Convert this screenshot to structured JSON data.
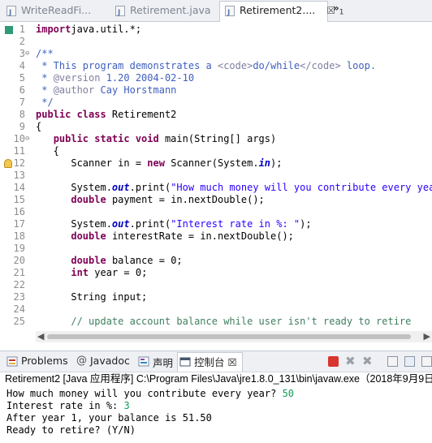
{
  "tabs": [
    {
      "label": "WriteReadFi...",
      "active": false
    },
    {
      "label": "Retirement.java",
      "active": false
    },
    {
      "label": "Retirement2....",
      "active": true,
      "close": "☒"
    }
  ],
  "overflow": {
    "symbol": "»",
    "count": "1"
  },
  "code_lines": [
    {
      "n": "1",
      "marker": "square",
      "parts": [
        [
          "kw",
          "import"
        ],
        [
          "",
          "java.util.*;"
        ]
      ]
    },
    {
      "n": "2",
      "parts": []
    },
    {
      "n": "3",
      "fold": "⊖",
      "parts": [
        [
          "cm",
          "/**"
        ]
      ]
    },
    {
      "n": "4",
      "parts": [
        [
          "cm",
          " * This program demonstrates a "
        ],
        [
          "tg",
          "<code>"
        ],
        [
          "cm",
          "do/while"
        ],
        [
          "tg",
          "</code>"
        ],
        [
          "cm",
          " loop."
        ]
      ]
    },
    {
      "n": "5",
      "parts": [
        [
          "cm",
          " * "
        ],
        [
          "tg",
          "@version"
        ],
        [
          "cm",
          " 1.20 2004-02-10"
        ]
      ]
    },
    {
      "n": "6",
      "parts": [
        [
          "cm",
          " * "
        ],
        [
          "tg",
          "@author"
        ],
        [
          "cm",
          " Cay Horstmann"
        ]
      ]
    },
    {
      "n": "7",
      "parts": [
        [
          "cm",
          " */"
        ]
      ]
    },
    {
      "n": "8",
      "parts": [
        [
          "kw",
          "public class"
        ],
        [
          "",
          " Retirement2"
        ]
      ]
    },
    {
      "n": "9",
      "parts": [
        [
          "",
          "{"
        ]
      ]
    },
    {
      "n": "10",
      "fold": "⊖",
      "parts": [
        [
          "",
          "   "
        ],
        [
          "kw",
          "public static void"
        ],
        [
          "",
          " main(String[] args)"
        ]
      ]
    },
    {
      "n": "11",
      "parts": [
        [
          "",
          "   {"
        ]
      ]
    },
    {
      "n": "12",
      "marker": "bulb",
      "parts": [
        [
          "",
          "      Scanner in = "
        ],
        [
          "kw",
          "new"
        ],
        [
          "",
          " Scanner(System."
        ],
        [
          "it",
          "in"
        ],
        [
          "",
          ");"
        ]
      ]
    },
    {
      "n": "13",
      "parts": []
    },
    {
      "n": "14",
      "parts": [
        [
          "",
          "      System."
        ],
        [
          "it",
          "out"
        ],
        [
          "",
          ".print("
        ],
        [
          "str",
          "\"How much money will you contribute every year?\""
        ]
      ]
    },
    {
      "n": "15",
      "parts": [
        [
          "",
          "      "
        ],
        [
          "kw",
          "double"
        ],
        [
          "",
          " payment = in.nextDouble();"
        ]
      ]
    },
    {
      "n": "16",
      "parts": []
    },
    {
      "n": "17",
      "parts": [
        [
          "",
          "      System."
        ],
        [
          "it",
          "out"
        ],
        [
          "",
          ".print("
        ],
        [
          "str",
          "\"Interest rate in %: \""
        ],
        [
          "",
          ");"
        ]
      ]
    },
    {
      "n": "18",
      "parts": [
        [
          "",
          "      "
        ],
        [
          "kw",
          "double"
        ],
        [
          "",
          " interestRate = in.nextDouble();"
        ]
      ]
    },
    {
      "n": "19",
      "parts": []
    },
    {
      "n": "20",
      "parts": [
        [
          "",
          "      "
        ],
        [
          "kw",
          "double"
        ],
        [
          "",
          " balance = 0;"
        ]
      ]
    },
    {
      "n": "21",
      "parts": [
        [
          "",
          "      "
        ],
        [
          "kw",
          "int"
        ],
        [
          "",
          " year = 0;"
        ]
      ]
    },
    {
      "n": "22",
      "parts": []
    },
    {
      "n": "23",
      "parts": [
        [
          "",
          "      String input;"
        ]
      ]
    },
    {
      "n": "24",
      "parts": []
    },
    {
      "n": "25",
      "parts": [
        [
          "lc",
          "      // update account balance while user isn't ready to retire"
        ]
      ]
    }
  ],
  "views": [
    {
      "label": "Problems",
      "icon": "problems-icon",
      "active": false
    },
    {
      "label": "Javadoc",
      "icon": "javadoc-icon",
      "active": false
    },
    {
      "label": "声明",
      "icon": "declaration-icon",
      "active": false
    },
    {
      "label": "控制台 ☒",
      "icon": "console-icon",
      "active": true
    }
  ],
  "console": {
    "title": "Retirement2 [Java 应用程序] C:\\Program Files\\Java\\jre1.8.0_131\\bin\\javaw.exe（2018年9月9日",
    "lines": [
      {
        "text": "How much money will you contribute every year? ",
        "input": "50"
      },
      {
        "text": "Interest rate in %: ",
        "input": "3"
      },
      {
        "text": "After year 1, your balance is 51.50",
        "input": ""
      },
      {
        "text": "Ready to retire? (Y/N)",
        "input": ""
      }
    ]
  },
  "colors": {
    "keyword": "#7f0055",
    "comment": "#3f5fbf",
    "string": "#2a00ff",
    "console_input": "#0f9d58"
  }
}
